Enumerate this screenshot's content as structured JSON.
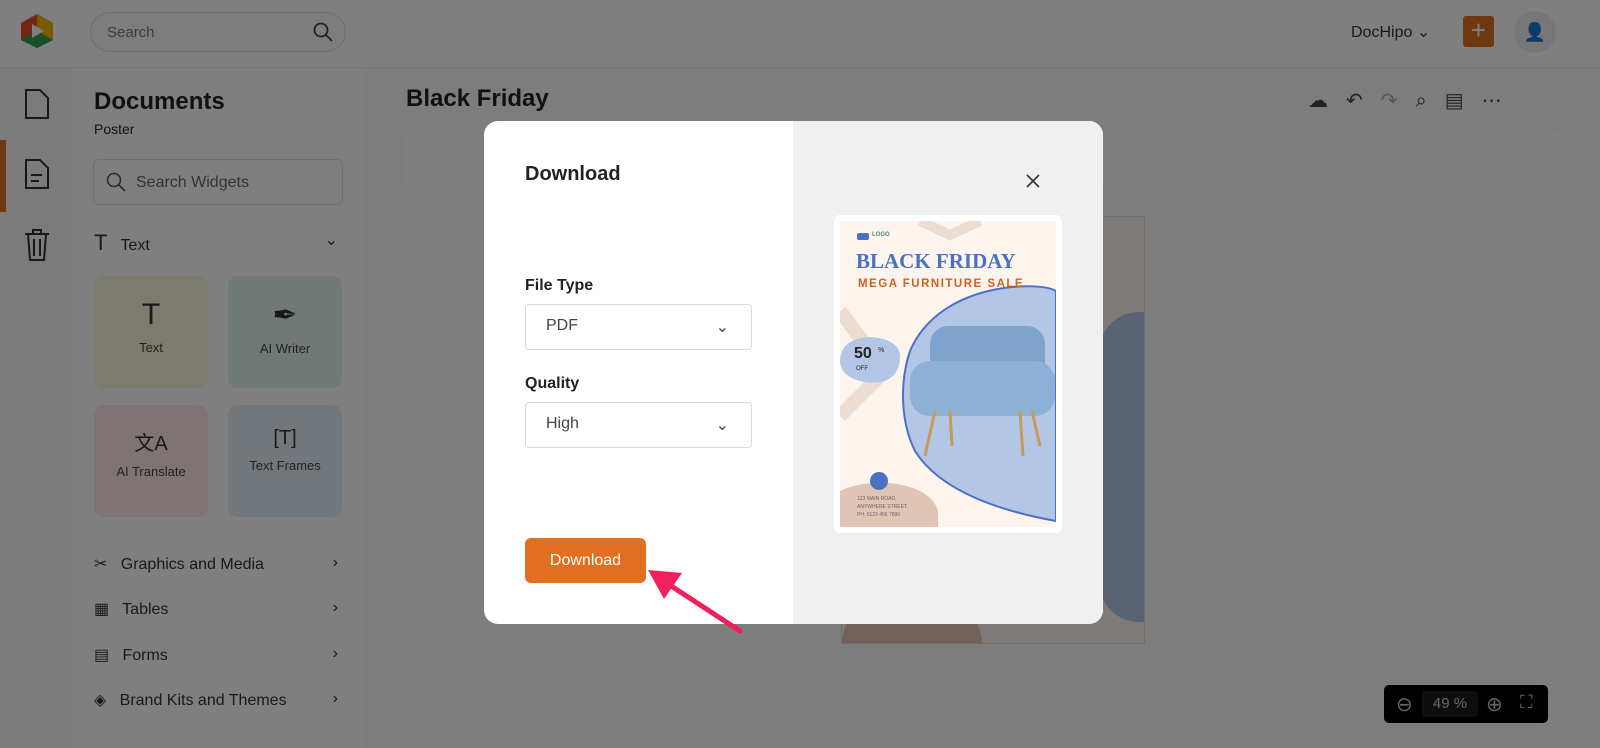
{
  "header": {
    "search_placeholder": "Search",
    "workspace": "DocHipo"
  },
  "sidebar": {
    "title": "Documents",
    "subtitle": "Poster",
    "search_placeholder": "Search Widgets",
    "text_section": "Text",
    "cards": [
      {
        "label": "Text",
        "icon": "T"
      },
      {
        "label": "AI Writer",
        "icon": "✒"
      },
      {
        "label": "AI Translate",
        "icon": "文A"
      },
      {
        "label": "Text Frames",
        "icon": "[T]"
      }
    ],
    "sections": [
      {
        "label": "Graphics and Media"
      },
      {
        "label": "Tables"
      },
      {
        "label": "Forms"
      },
      {
        "label": "Brand Kits and Themes"
      }
    ]
  },
  "document": {
    "title": "Black Friday"
  },
  "zoom": {
    "value": "49",
    "unit": "%"
  },
  "modal": {
    "title": "Download",
    "file_type_label": "File Type",
    "file_type_value": "PDF",
    "quality_label": "Quality",
    "quality_value": "High",
    "download_button": "Download"
  },
  "poster": {
    "logo": "LOGO",
    "title": "BLACK FRIDAY",
    "subtitle": "MEGA FURNITURE SALE",
    "discount": "50",
    "discount_unit": "%",
    "off": "OFF",
    "address_1": "123 MAIN ROAD,",
    "address_2": "ANYWHERE STREET,",
    "phone": "PH: 0123 456 7890"
  },
  "colors": {
    "accent": "#e07020",
    "arrow": "#f0205a",
    "poster_blue": "#4a72c4",
    "poster_orange": "#d0601c"
  }
}
